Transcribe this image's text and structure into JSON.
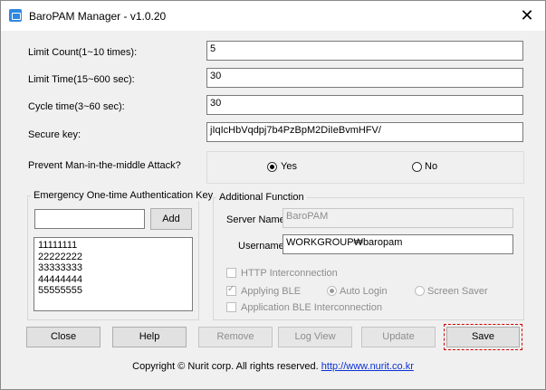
{
  "window": {
    "title": "BaroPAM Manager - v1.0.20",
    "close_glyph": "✕"
  },
  "settings": {
    "limit_count": {
      "label": "Limit Count(1~10 times):",
      "value": "5"
    },
    "limit_time": {
      "label": "Limit Time(15~600 sec):",
      "value": "30"
    },
    "cycle_time": {
      "label": "Cycle time(3~60 sec):",
      "value": "30"
    },
    "secure_key": {
      "label": "Secure key:",
      "value": "jIqIcHbVqdpj7b4PzBpM2DiIeBvmHFV/"
    },
    "mitm": {
      "label": "Prevent Man-in-the-middle Attack?",
      "yes": "Yes",
      "no": "No",
      "selected": "Yes"
    }
  },
  "emergency": {
    "legend": "Emergency One-time Authentication Key",
    "input_value": "",
    "add_label": "Add",
    "keys": [
      "11111111",
      "22222222",
      "33333333",
      "44444444",
      "55555555"
    ]
  },
  "additional": {
    "legend": "Additional Function",
    "server_name_label": "Server Name",
    "server_name_value": "BaroPAM",
    "username_label": "Username",
    "username_value": "WORKGROUP₩baropam",
    "http_label": "HTTP Interconnection",
    "http_checked": false,
    "ble_label": "Applying BLE",
    "ble_checked": true,
    "auto_login_label": "Auto Login",
    "screen_saver_label": "Screen Saver",
    "ble_mode": "Auto Login",
    "app_ble_label": "Application BLE Interconnection",
    "app_ble_checked": false
  },
  "buttons": {
    "close": "Close",
    "help": "Help",
    "remove": "Remove",
    "log_view": "Log View",
    "update": "Update",
    "save": "Save"
  },
  "footer": {
    "copyright": "Copyright © Nurit corp. All rights reserved.",
    "link": "http://www.nurit.co.kr"
  },
  "colors": {
    "link": "#0b31d6",
    "focus_outline": "#d40000",
    "app_icon": "#2f88e2"
  }
}
